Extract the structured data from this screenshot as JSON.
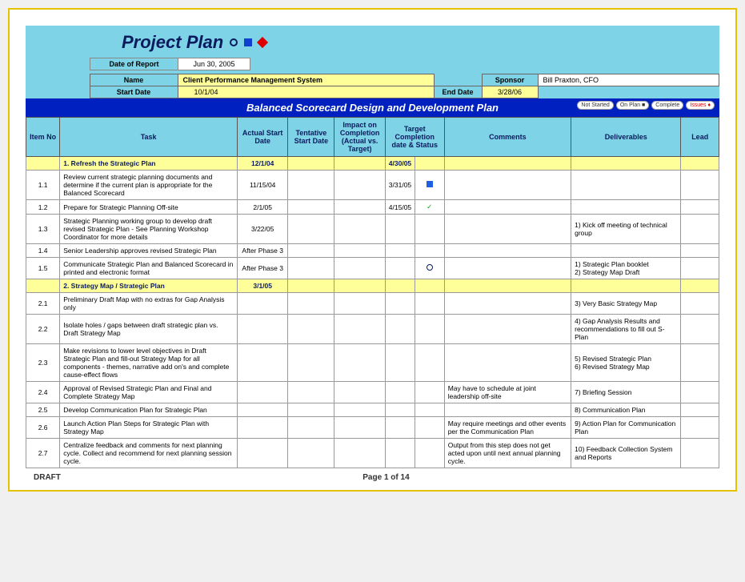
{
  "title": "Project Plan",
  "report_date_label": "Date of Report",
  "report_date": "Jun 30, 2005",
  "name_label": "Name",
  "name": "Client Performance Management System",
  "sponsor_label": "Sponsor",
  "sponsor": "Bill Praxton, CFO",
  "start_date_label": "Start Date",
  "start_date": "10/1/04",
  "end_date_label": "End Date",
  "end_date": "3/28/06",
  "section_title": "Balanced Scorecard Design and Development Plan",
  "legend": {
    "a": "Not Started",
    "b": "On Plan ■",
    "c": "Complete",
    "d": "Issues ♦"
  },
  "headers": {
    "item": "Item No",
    "task": "Task",
    "astart": "Actual Start Date",
    "tstart": "Tentative Start Date",
    "impact": "Impact on Completion (Actual vs. Target)",
    "target": "Target Completion date & Status",
    "comments": "Comments",
    "deliv": "Deliverables",
    "lead": "Lead"
  },
  "rows": [
    {
      "section": true,
      "item": "",
      "task": "1. Refresh the Strategic Plan",
      "astart": "12/1/04",
      "target": "4/30/05"
    },
    {
      "item": "1.1",
      "task": "Review current strategic planning documents and determine if the current plan is appropriate for the Balanced Scorecard",
      "astart": "11/15/04",
      "target": "3/31/05",
      "status": "square"
    },
    {
      "item": "1.2",
      "task": "Prepare for Strategic Planning Off-site",
      "astart": "2/1/05",
      "target": "4/15/05",
      "status": "check"
    },
    {
      "item": "1.3",
      "task": "Strategic Planning working group to develop draft revised Strategic Plan - See Planning Workshop Coordinator for more details",
      "astart": "3/22/05",
      "deliv": "1) Kick off meeting of technical group"
    },
    {
      "item": "1.4",
      "task": "Senior Leadership approves revised Strategic Plan",
      "astart": "After Phase 3"
    },
    {
      "item": "1.5",
      "task": "Communicate Strategic Plan and Balanced Scorecard in printed and electronic format",
      "astart": "After Phase 3",
      "status": "circle",
      "deliv": "1) Strategic Plan booklet\n2) Strategy Map Draft"
    },
    {
      "section": true,
      "item": "",
      "task": "2. Strategy Map / Strategic Plan",
      "astart": "3/1/05"
    },
    {
      "item": "2.1",
      "task": "Preliminary Draft Map with no extras for Gap Analysis only",
      "deliv": "3) Very Basic Strategy Map"
    },
    {
      "item": "2.2",
      "task": "Isolate holes / gaps between draft strategic plan vs. Draft Strategy Map",
      "deliv": "4) Gap Analysis Results and recommendations to fill out S-Plan"
    },
    {
      "item": "2.3",
      "task": "Make revisions to lower level objectives in Draft Strategic Plan and fill-out Strategy Map for all components - themes, narrative add on's and complete cause-effect flows",
      "deliv": "5) Revised Strategic Plan\n6) Revised Strategy Map"
    },
    {
      "item": "2.4",
      "task": "Approval of Revised Strategic Plan and Final and Complete Strategy Map",
      "comments": "May have to schedule at joint leadership off-site",
      "deliv": "7) Briefing Session"
    },
    {
      "item": "2.5",
      "task": "Develop Communication Plan for Strategic Plan",
      "deliv": "8) Communication Plan"
    },
    {
      "item": "2.6",
      "task": "Launch Action Plan Steps for Strategic Plan with Strategy Map",
      "comments": "May require meetings and other events per the Communication Plan",
      "deliv": "9) Action Plan for Communication Plan"
    },
    {
      "item": "2.7",
      "task": "Centralize feedback and comments for next planning cycle. Collect and recommend for next planning session cycle.",
      "comments": "Output from this step does not get acted upon until next annual planning cycle.",
      "deliv": "10) Feedback Collection System and Reports"
    }
  ],
  "footer": {
    "draft": "DRAFT",
    "page": "Page 1 of 14"
  }
}
